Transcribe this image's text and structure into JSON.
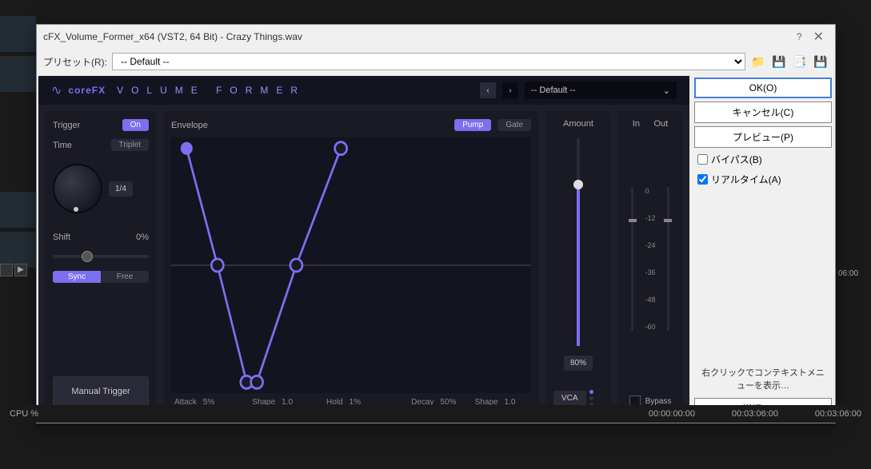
{
  "bg": {
    "filename": ".wav",
    "timeline": "06:00",
    "play_icon": "▶"
  },
  "dialog": {
    "title": "cFX_Volume_Former_x64    (VST2, 64 Bit) - Crazy Things.wav",
    "help": "?",
    "preset_label": "プリセット(R):",
    "preset_value": "-- Default --"
  },
  "icons": {
    "folder": "📁",
    "save": "💾",
    "copy": "📑",
    "save2": "💾"
  },
  "plugin": {
    "brand": "coreFX",
    "product": "VOLUME FORMER",
    "nav_prev": "‹",
    "nav_next": "›",
    "preset": "-- Default --",
    "dd_arrow": "⌄"
  },
  "trigger": {
    "label": "Trigger",
    "on": "On",
    "time_label": "Time",
    "triplet": "Triplet",
    "time_value": "1/4",
    "shift_label": "Shift",
    "shift_value": "0%",
    "sync": "Sync",
    "free": "Free",
    "manual": "Manual Trigger"
  },
  "envelope": {
    "label": "Envelope",
    "pump": "Pump",
    "gate": "Gate",
    "labels": {
      "attack": "Attack",
      "attack_val": "5%",
      "shape1": "Shape",
      "shape1_val": "1.0",
      "hold": "Hold",
      "hold_val": "1%",
      "decay": "Decay",
      "decay_val": "50%",
      "shape2": "Shape",
      "shape2_val": "1.0"
    }
  },
  "chart_data": {
    "type": "line",
    "title": "Envelope",
    "x_range": [
      0,
      1
    ],
    "y_range": [
      0,
      1
    ],
    "points": [
      {
        "x": 0.04,
        "y": 0.96
      },
      {
        "x": 0.13,
        "y": 0.5
      },
      {
        "x": 0.21,
        "y": 0.04
      },
      {
        "x": 0.24,
        "y": 0.04
      },
      {
        "x": 0.35,
        "y": 0.5
      },
      {
        "x": 0.47,
        "y": 0.96
      }
    ]
  },
  "amount": {
    "label": "Amount",
    "value": "80%",
    "vca": "VCA"
  },
  "io": {
    "in": "In",
    "out": "Out",
    "scale": [
      "0",
      "-12",
      "-24",
      "-36",
      "-48",
      "-60"
    ],
    "bypass": "Bypass"
  },
  "sidebar": {
    "ok": "OK(O)",
    "cancel": "キャンセル(C)",
    "preview": "プレビュー(P)",
    "bypass": "バイパス(B)",
    "realtime": "リアルタイム(A)",
    "hint": "右クリックでコンテキストメニューを表示…",
    "details": "詳細(E)…"
  },
  "status": {
    "cpu": "CPU %",
    "t1": "00:00:00:00",
    "t2": "00:03:06:00",
    "t3": "00:03:06:00"
  }
}
